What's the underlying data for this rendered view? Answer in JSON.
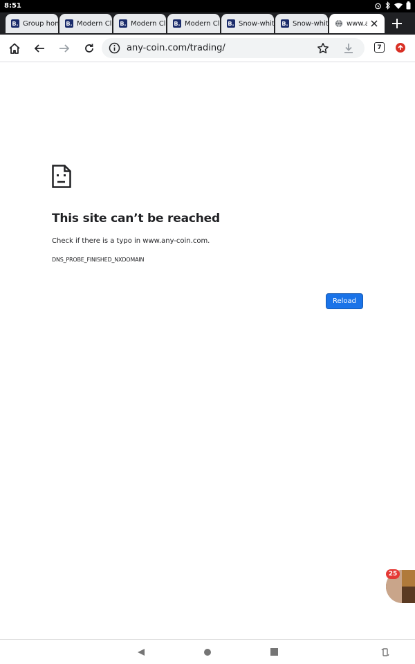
{
  "status_bar": {
    "time": "8:51",
    "icons": [
      "alarm-icon",
      "bluetooth-icon",
      "wifi-icon",
      "battery-icon"
    ]
  },
  "tabs": [
    {
      "label": "Group hon",
      "favicon": "B.",
      "active": false
    },
    {
      "label": "Modern Cl",
      "favicon": "B.",
      "active": false
    },
    {
      "label": "Modern Cl",
      "favicon": "B.",
      "active": false
    },
    {
      "label": "Modern Cl",
      "favicon": "B.",
      "active": false
    },
    {
      "label": "Snow-whit",
      "favicon": "B.",
      "active": false
    },
    {
      "label": "Snow-whit",
      "favicon": "B.",
      "active": false
    },
    {
      "label": "www.a",
      "favicon": "globe-icon",
      "active": true
    }
  ],
  "toolbar": {
    "url": "any-coin.com/trading/",
    "tab_count": "7"
  },
  "error_page": {
    "title": "This site can’t be reached",
    "body": "Check if there is a typo in www.any-coin.com.",
    "error_code": "DNS_PROBE_FINISHED_NXDOMAIN",
    "reload_label": "Reload"
  },
  "chat_head": {
    "badge_count": "25"
  },
  "colors": {
    "accent": "#1a73e8",
    "tab_strip": "#202124",
    "badge": "#e53935"
  }
}
